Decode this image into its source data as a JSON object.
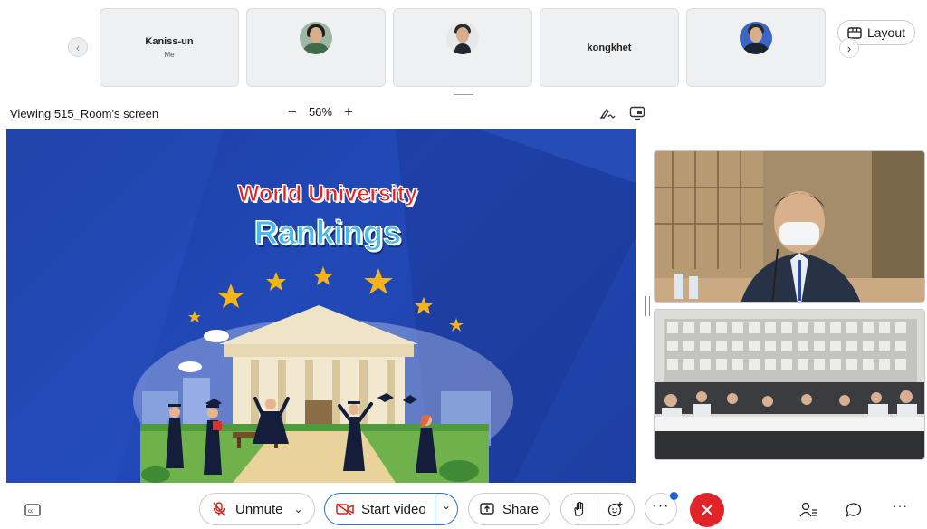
{
  "participants": {
    "tiles": [
      {
        "name": "Kaniss-un",
        "subtitle": "Me",
        "type": "name"
      },
      {
        "name": "",
        "subtitle": "",
        "type": "avatar-woman"
      },
      {
        "name": "",
        "subtitle": "",
        "type": "avatar-man"
      },
      {
        "name": "kongkhet",
        "subtitle": "",
        "type": "name"
      },
      {
        "name": "",
        "subtitle": "",
        "type": "avatar-man2"
      }
    ],
    "layout_label": "Layout"
  },
  "viewer": {
    "viewing_label": "Viewing 515_Room's screen",
    "zoom": "56%"
  },
  "slide": {
    "title_line1": "World University",
    "title_line2": "Rankings"
  },
  "toolbar": {
    "unmute_label": "Unmute",
    "start_video_label": "Start video",
    "share_label": "Share"
  },
  "colors": {
    "end_call": "#e0242a",
    "slide_bg": "#2249b8",
    "notification_dot": "#1f5fd0"
  }
}
